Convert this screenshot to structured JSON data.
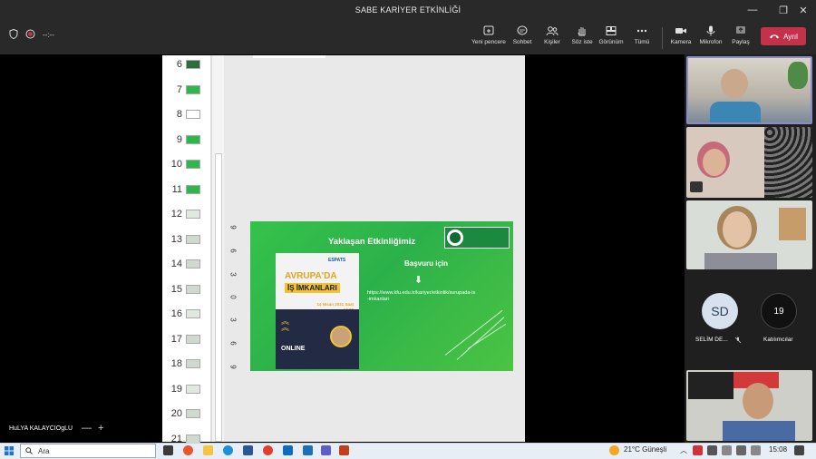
{
  "window": {
    "title": "SABE KARİYER ETKİNLİĞİ",
    "controls": [
      "minimize",
      "restore",
      "close"
    ]
  },
  "toolbar": {
    "timer": "--:--",
    "buttons": [
      {
        "label": "Yeni pencere",
        "icon": "new-window-icon"
      },
      {
        "label": "Sohbet",
        "icon": "chat-icon"
      },
      {
        "label": "Kişiler",
        "icon": "people-icon"
      },
      {
        "label": "Söz iste",
        "icon": "raise-hand-icon"
      },
      {
        "label": "Görünüm",
        "icon": "view-icon"
      },
      {
        "label": "Tümü",
        "icon": "more-icon"
      },
      {
        "label": "Kamera",
        "icon": "camera-icon"
      },
      {
        "label": "Mikrofon",
        "icon": "mic-icon"
      },
      {
        "label": "Paylaş",
        "icon": "share-icon"
      }
    ],
    "leave_label": "Ayrıl"
  },
  "thumbnails": [
    "6",
    "7",
    "8",
    "9",
    "10",
    "11",
    "12",
    "13",
    "14",
    "15",
    "16",
    "17",
    "18",
    "19",
    "20",
    "21"
  ],
  "ruler": [
    "9",
    "6",
    "3",
    "0",
    "3",
    "6",
    "9"
  ],
  "slide": {
    "title": "Yaklaşan Etkinliğimiz",
    "apply": "Başvuru için",
    "arrow": "⬇",
    "url": "https://www.kfu.edu.tr/kariyer/etkinlik/avrupada-is-imkanlari",
    "poster": {
      "brand": "ESPATS",
      "title1": "AVRUPA'DA",
      "title2": "İŞ İMKANLARI",
      "date": "14 Nisan 2021 Saat 14.00",
      "online": "ONLINE"
    }
  },
  "participants": {
    "initials": "SD",
    "initials_name": "SELİM DE...",
    "count": "19",
    "count_label": "Katılımcılar"
  },
  "presenter": {
    "name": "HuLYA KALAYCIOgLU",
    "zoom_out": "—",
    "zoom_in": "+"
  },
  "taskbar": {
    "search_placeholder": "Ara",
    "weather": "21°C Güneşli",
    "clock": "15:08"
  },
  "colors": {
    "accent": "#8b8cc7",
    "leave": "#c4314b",
    "slide_green": "#2cb14a"
  }
}
